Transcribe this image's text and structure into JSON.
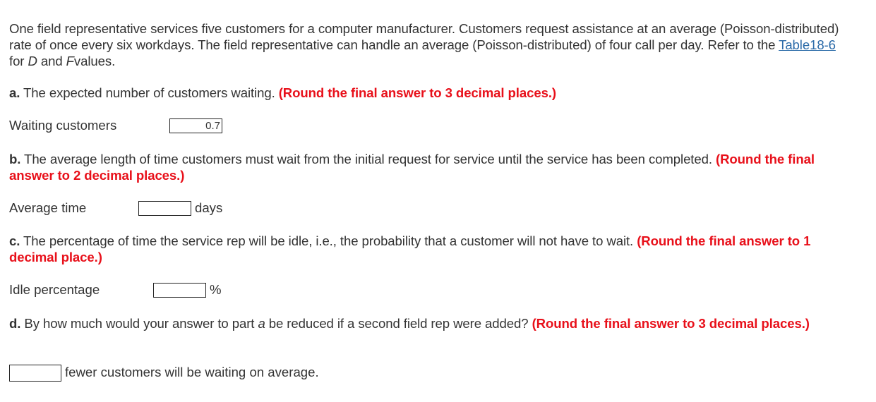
{
  "intro": {
    "text_before_link": "One field representative services five customers for a computer manufacturer. Customers request assistance at an average (Poisson-distributed) rate of once every six workdays. The field representative can handle an average (Poisson-distributed) of four call per day. Refer to the ",
    "link_text": "Table18-6",
    "text_for": " for ",
    "var_d": "D",
    "text_and": " and ",
    "var_f": "F",
    "text_end": "values."
  },
  "parts": {
    "a": {
      "letter": "a.",
      "question": " The expected number of customers waiting. ",
      "instruction": "(Round the final answer to 3 decimal places.)",
      "field_label": "Waiting customers",
      "value": "0.7",
      "unit": ""
    },
    "b": {
      "letter": "b.",
      "question": " The average length of time customers must wait from the initial request for service until the service has been completed. ",
      "instruction": "(Round the final answer to 2 decimal places.)",
      "field_label": "Average time",
      "value": "",
      "unit": "days"
    },
    "c": {
      "letter": "c.",
      "question": " The percentage of time the service rep will be idle, i.e., the probability that a customer will not have to wait. ",
      "instruction": "(Round the final answer to 1 decimal place.)",
      "field_label": "Idle percentage",
      "value": "",
      "unit": "%"
    },
    "d": {
      "letter": "d.",
      "question_before": " By how much would your answer to part ",
      "question_var": "a",
      "question_after": " be reduced if a second field rep were added? ",
      "instruction": "(Round the final answer to 3 decimal places.)",
      "value": "",
      "unit": "fewer customers will be waiting on average."
    }
  },
  "colors": {
    "text": "#333333",
    "instruction": "#e8101a",
    "link": "#2a6aa8"
  }
}
